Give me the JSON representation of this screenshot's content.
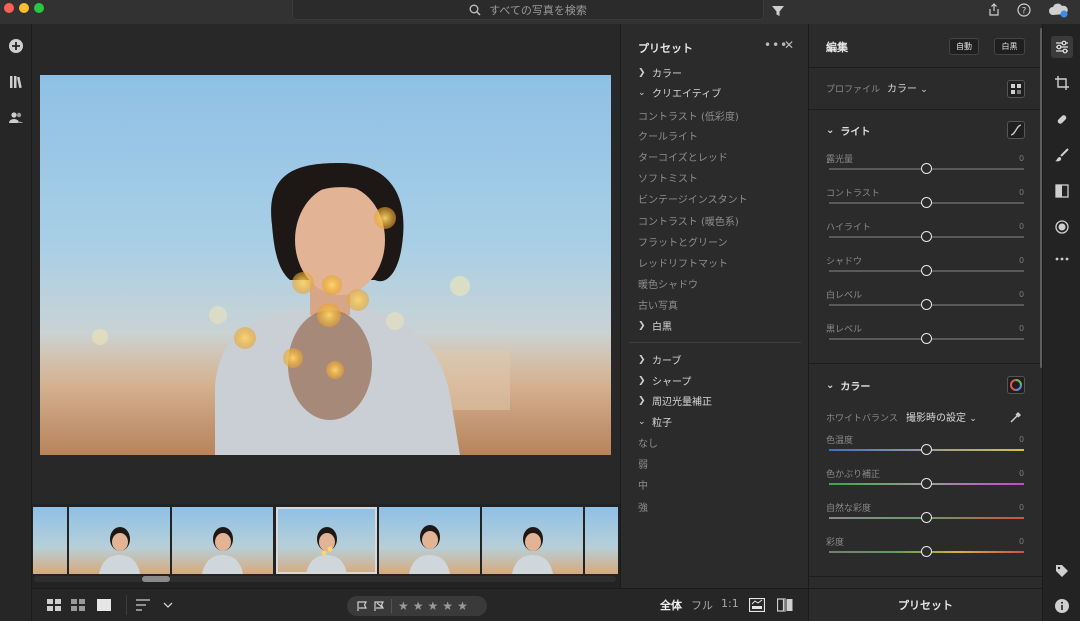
{
  "search": {
    "placeholder": "すべての写真を検索"
  },
  "presets_panel": {
    "title": "プリセット",
    "more": "•••",
    "close": "✕",
    "groups_top": [
      {
        "label": "カラー",
        "expanded": false
      },
      {
        "label": "クリエイティブ",
        "expanded": true
      }
    ],
    "creative_items": [
      "コントラスト (低彩度)",
      "クールライト",
      "ターコイズとレッド",
      "ソフトミスト",
      "ビンテージインスタント",
      "コントラスト (暖色系)",
      "フラットとグリーン",
      "レッドリフトマット",
      "暖色シャドウ",
      "古い写真"
    ],
    "bw_group": "白黒",
    "groups_bottom": [
      {
        "label": "カーブ",
        "expanded": false
      },
      {
        "label": "シャープ",
        "expanded": false
      },
      {
        "label": "周辺光量補正",
        "expanded": false
      },
      {
        "label": "粒子",
        "expanded": true
      }
    ],
    "grain_items": [
      "なし",
      "弱",
      "中",
      "強"
    ]
  },
  "edit_panel": {
    "title": "編集",
    "auto_button": "自動",
    "bw_button": "白黒",
    "profile_label": "プロファイル",
    "profile_value": "カラー",
    "light_section": "ライト",
    "light_sliders": [
      {
        "label": "露光量",
        "value": "0",
        "fraction": 0.5
      },
      {
        "label": "コントラスト",
        "value": "0",
        "fraction": 0.5
      },
      {
        "label": "ハイライト",
        "value": "0",
        "fraction": 0.5
      },
      {
        "label": "シャドウ",
        "value": "0",
        "fraction": 0.5
      },
      {
        "label": "白レベル",
        "value": "0",
        "fraction": 0.5
      },
      {
        "label": "黒レベル",
        "value": "0",
        "fraction": 0.5
      }
    ],
    "color_section": "カラー",
    "wb_label": "ホワイトバランス",
    "wb_value": "撮影時の設定",
    "color_sliders": [
      {
        "label": "色温度",
        "value": "0",
        "fraction": 0.5
      },
      {
        "label": "色かぶり補正",
        "value": "0",
        "fraction": 0.5
      },
      {
        "label": "自然な彩度",
        "value": "0",
        "fraction": 0.5
      },
      {
        "label": "彩度",
        "value": "0",
        "fraction": 0.5
      }
    ]
  },
  "bottom_bar": {
    "view_all": "全体",
    "view_full": "フル",
    "view_1to1": "1:1",
    "stars_filled": 0,
    "stars_total": 5
  },
  "presets_footer": "プリセット",
  "colors": {
    "background": "#1f1f1f",
    "panel": "#2b2b2b",
    "text": "#e6e6e6",
    "muted": "#8a8a8a"
  }
}
